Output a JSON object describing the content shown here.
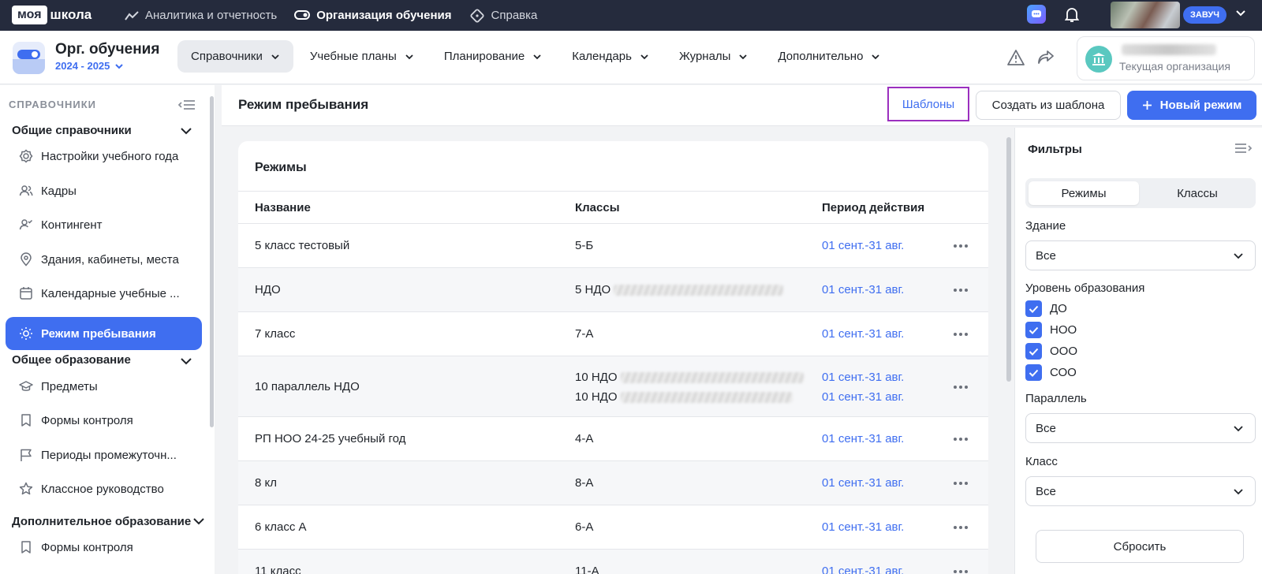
{
  "topbar": {
    "logo_part1": "моя",
    "logo_part2": "школа",
    "nav": [
      {
        "label": "Аналитика и отчетность",
        "icon": "analytics-icon"
      },
      {
        "label": "Организация обучения",
        "icon": "organization-icon"
      },
      {
        "label": "Справка",
        "icon": "help-icon"
      }
    ],
    "role": "ЗАВУЧ"
  },
  "header": {
    "title": "Орг. обучения",
    "year": "2024 - 2025",
    "nav": [
      "Справочники",
      "Учебные планы",
      "Планирование",
      "Календарь",
      "Журналы",
      "Дополнительно"
    ],
    "org_label": "Текущая организация"
  },
  "sidebar": {
    "heading": "СПРАВОЧНИКИ",
    "groups": [
      {
        "title": "Общие справочники",
        "items": [
          {
            "label": "Настройки учебного года",
            "icon": "settings-icon"
          },
          {
            "label": "Кадры",
            "icon": "people-icon"
          },
          {
            "label": "Контингент",
            "icon": "contingent-icon"
          },
          {
            "label": "Здания, кабинеты, места",
            "icon": "location-icon"
          },
          {
            "label": "Календарные учебные ...",
            "icon": "calendar-icon"
          },
          {
            "label": "Режим пребывания",
            "icon": "sun-icon"
          }
        ]
      },
      {
        "title": "Общее образование",
        "items": [
          {
            "label": "Предметы",
            "icon": "graduation-cap-icon"
          },
          {
            "label": "Формы контроля",
            "icon": "bookmark-icon"
          },
          {
            "label": "Периоды промежуточн...",
            "icon": "flag-icon"
          },
          {
            "label": "Классное руководство",
            "icon": "star-icon"
          }
        ]
      },
      {
        "title": "Дополнительное образование",
        "items": [
          {
            "label": "Формы контроля",
            "icon": "bookmark-icon"
          }
        ]
      }
    ]
  },
  "content": {
    "title": "Режим пребывания",
    "btn_templates": "Шаблоны",
    "btn_create_from_template": "Создать из шаблона",
    "btn_new": "Новый режим"
  },
  "table": {
    "title": "Режимы",
    "columns": [
      "Название",
      "Классы",
      "Период действия"
    ],
    "rows": [
      {
        "name": "5 класс тестовый",
        "classes": [
          "5-Б"
        ],
        "periods": [
          "01 сент.-31 авг."
        ]
      },
      {
        "name": "НДО",
        "classes": [
          "5 НДО"
        ],
        "periods": [
          "01 сент.-31 авг."
        ]
      },
      {
        "name": "7 класс",
        "classes": [
          "7-А"
        ],
        "periods": [
          "01 сент.-31 авг."
        ]
      },
      {
        "name": "10 параллель НДО",
        "classes": [
          "10 НДО",
          "10 НДО"
        ],
        "periods": [
          "01 сент.-31 авг.",
          "01 сент.-31 авг."
        ]
      },
      {
        "name": "РП НОО 24-25 учебный год",
        "classes": [
          "4-А"
        ],
        "periods": [
          "01 сент.-31 авг."
        ]
      },
      {
        "name": "8 кл",
        "classes": [
          "8-А"
        ],
        "periods": [
          "01 сент.-31 авг."
        ]
      },
      {
        "name": "6 класс А",
        "classes": [
          "6-А"
        ],
        "periods": [
          "01 сент.-31 авг."
        ]
      },
      {
        "name": "11 класс",
        "classes": [
          "11-А"
        ],
        "periods": [
          "01 сент.-31 авг."
        ]
      }
    ]
  },
  "filters": {
    "title": "Фильтры",
    "tabs": [
      "Режимы",
      "Классы"
    ],
    "building_label": "Здание",
    "building_value": "Все",
    "level_label": "Уровень образования",
    "levels": [
      "ДО",
      "НОО",
      "ООО",
      "СОО"
    ],
    "parallel_label": "Параллель",
    "parallel_value": "Все",
    "class_label": "Класс",
    "class_value": "Все",
    "reset": "Сбросить"
  },
  "colors": {
    "accent": "#3f6ef0",
    "topbar": "#252b3d",
    "highlight": "#9b2fbf"
  }
}
